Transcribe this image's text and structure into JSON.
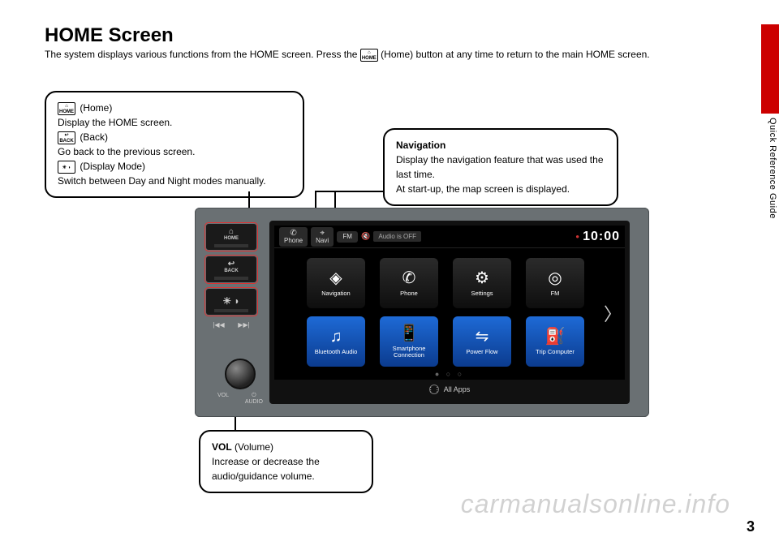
{
  "page": {
    "title": "HOME Screen",
    "subtitle_pre": "The system displays various functions from the HOME screen. Press the ",
    "subtitle_icon_top": "⌂",
    "subtitle_icon_bottom": "HOME",
    "subtitle_post": " (Home) button at any time to return to the main HOME screen.",
    "side_label": "Quick Reference Guide",
    "page_number": "3",
    "watermark": "carmanualsonline.info"
  },
  "callouts": {
    "buttons": {
      "home_label": "(Home)",
      "home_desc": "Display the HOME screen.",
      "back_label": "(Back)",
      "back_desc": "Go back to the previous screen.",
      "disp_label": "(Display Mode)",
      "disp_desc": "Switch between Day and Night modes manually.",
      "home_icon_top": "⌂",
      "home_icon_bottom": "HOME",
      "back_icon_top": "↩",
      "back_icon_bottom": "BACK",
      "disp_icon": "☀ ◗"
    },
    "nav": {
      "title": "Navigation",
      "line1": "Display the navigation feature that was used the last time.",
      "line2": "At start-up, the map screen is displayed."
    },
    "vol": {
      "title": "VOL",
      "title_paren": " (Volume)",
      "desc": "Increase or decrease the audio/guidance volume."
    }
  },
  "unit": {
    "buttons": {
      "home_top": "⌂",
      "home": "HOME",
      "back_top": "↩",
      "back": "BACK",
      "disp": "☀ ◗",
      "seek_prev": "|◀◀",
      "seek_next": "▶▶|",
      "vol": "VOL",
      "audio_top": "⏻",
      "audio": "AUDIO"
    },
    "topbar": {
      "phone": "Phone",
      "navi": "Navi",
      "fm": "FM",
      "audio_status": "Audio is OFF",
      "clock": "10:00"
    },
    "tiles": [
      {
        "label": "Navigation",
        "icon": "◈",
        "cls": "t-black"
      },
      {
        "label": "Phone",
        "icon": "✆",
        "cls": "t-black"
      },
      {
        "label": "Settings",
        "icon": "⚙",
        "cls": "t-black"
      },
      {
        "label": "FM",
        "icon": "◎",
        "cls": "t-black"
      },
      {
        "label": "Bluetooth Audio",
        "icon": "♫",
        "cls": "t-blue"
      },
      {
        "label": "Smartphone Connection",
        "icon": "📱",
        "cls": "t-blue"
      },
      {
        "label": "Power Flow",
        "icon": "⇋",
        "cls": "t-blue"
      },
      {
        "label": "Trip Computer",
        "icon": "⛽",
        "cls": "t-blue"
      }
    ],
    "all_apps": "All Apps",
    "arrow": "〉"
  }
}
